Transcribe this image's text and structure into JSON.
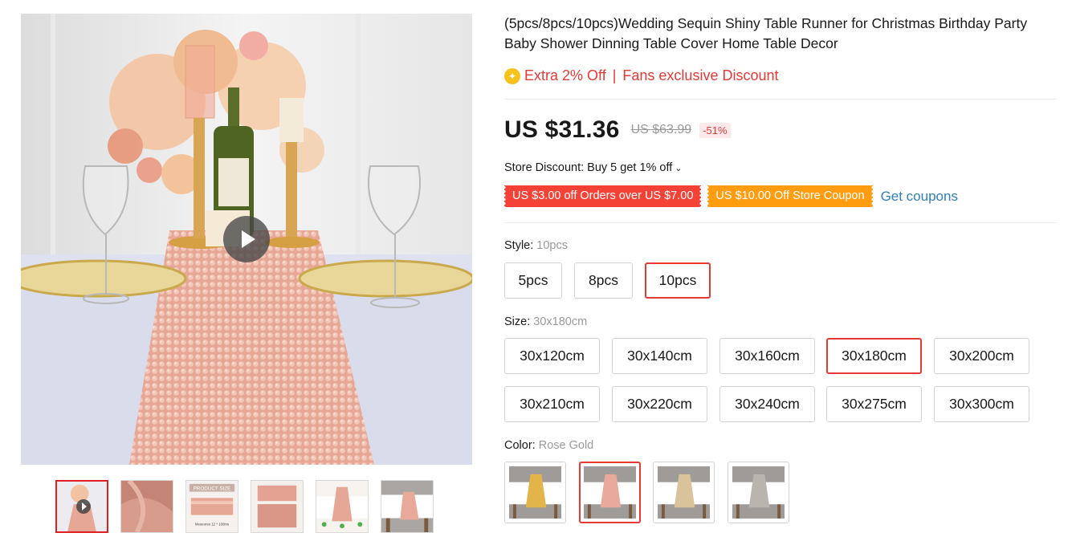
{
  "product": {
    "title": "(5pcs/8pcs/10pcs)Wedding Sequin Shiny Table Runner for Christmas Birthday Party Baby Shower Dinning Table Cover Home Table Decor"
  },
  "promo": {
    "badge": "✦",
    "extra": "Extra 2% Off",
    "separator": "|",
    "fans": "Fans exclusive Discount"
  },
  "pricing": {
    "current": "US $31.36",
    "original": "US $63.99",
    "discount": "-51%"
  },
  "store_discount": {
    "text": "Store Discount: Buy 5 get 1% off",
    "chevron": "⌄"
  },
  "coupons": [
    {
      "label": "US $3.00 off Orders over US $7.00",
      "color": "#f44336"
    },
    {
      "label": "US $10.00 Off Store Coupon",
      "color": "#ff9c10"
    }
  ],
  "get_coupons_label": "Get coupons",
  "style": {
    "label": "Style:",
    "selected": "10pcs",
    "options": [
      "5pcs",
      "8pcs",
      "10pcs"
    ]
  },
  "size": {
    "label": "Size:",
    "selected": "30x180cm",
    "options": [
      "30x120cm",
      "30x140cm",
      "30x160cm",
      "30x180cm",
      "30x200cm",
      "30x210cm",
      "30x220cm",
      "30x240cm",
      "30x275cm",
      "30x300cm"
    ]
  },
  "color": {
    "label": "Color:",
    "selected": "Rose Gold",
    "swatch_colors": [
      "#e3b44a",
      "#e9a99a",
      "#d8c39a",
      "#b9b4ad"
    ],
    "selected_index": 1
  },
  "gallery": {
    "thumbnail_count": 6,
    "active_index": 0,
    "thumb_texts": {
      "product_size": "PRODUCT SIZE",
      "measures": "Measures 12 * 108ins"
    }
  },
  "theme": {
    "accent": "#e53935",
    "link": "#2e7fb8",
    "sequin": "#e8a898"
  }
}
